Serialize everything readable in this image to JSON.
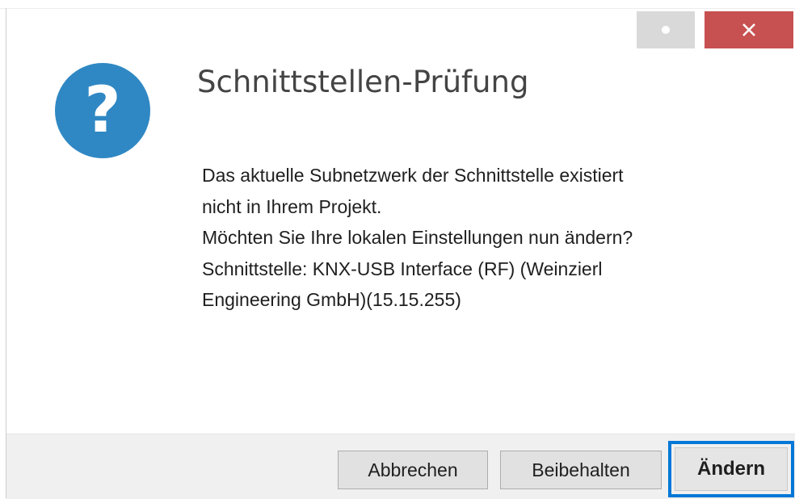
{
  "window": {
    "title": "Schnittstellen-Prüfung",
    "controls": {
      "help_icon": "circle-dot-icon",
      "close_icon": "close-icon"
    }
  },
  "dialog": {
    "icon": "question-icon",
    "icon_glyph": "?",
    "icon_color": "#2f88c3",
    "message_lines": [
      "Das aktuelle Subnetzwerk der Schnittstelle existiert",
      "nicht in Ihrem Projekt.",
      "Möchten Sie Ihre lokalen Einstellungen nun ändern?",
      "Schnittstelle: KNX-USB Interface (RF) (Weinzierl",
      "Engineering GmbH)(15.15.255)"
    ]
  },
  "buttons": {
    "cancel": "Abbrechen",
    "keep": "Beibehalten",
    "change": "Ändern"
  },
  "colors": {
    "close_button": "#c75050",
    "focus_outline": "#0078d7",
    "footer": "#f0f0f0"
  }
}
